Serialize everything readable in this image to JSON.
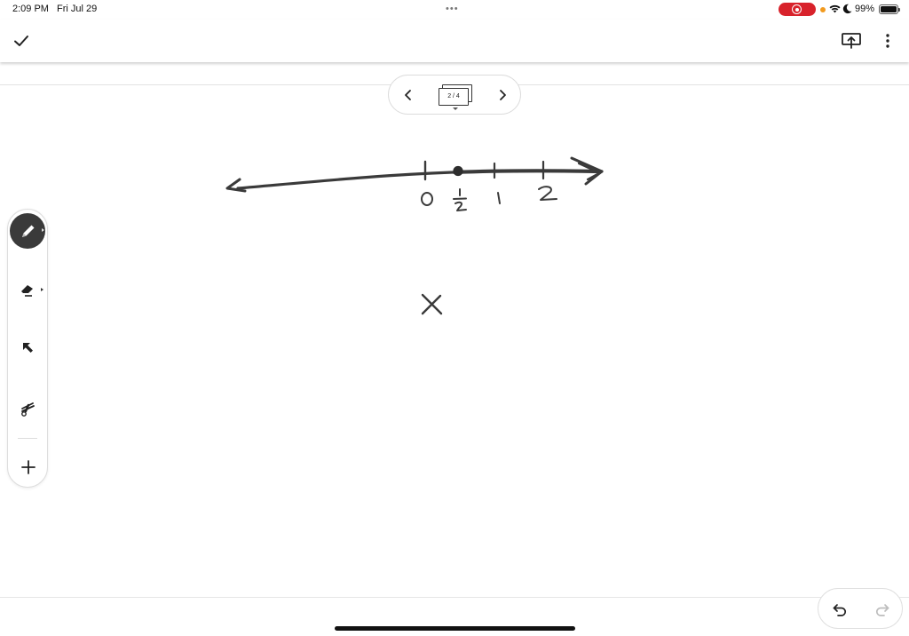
{
  "status_bar": {
    "time": "2:09 PM",
    "date": "Fri Jul 29",
    "multitask_dots": "•••",
    "battery_percent": "99%",
    "battery_level": 0.99,
    "recording_color": "#d8222b"
  },
  "toolbar": {
    "done_icon": "checkmark-icon",
    "present_icon": "present-screen-icon",
    "more_icon": "more-vertical-icon"
  },
  "page_nav": {
    "current_page": 2,
    "total_pages": 4,
    "counter_text": "2 / 4"
  },
  "tools": {
    "items": [
      "pen",
      "eraser",
      "select-arrow",
      "laser-pointer",
      "add"
    ],
    "active": "pen"
  },
  "canvas": {
    "number_line_labels": [
      "0",
      "½",
      "1",
      "2"
    ],
    "variable": "X",
    "ink_color": "#3a3a3a"
  }
}
